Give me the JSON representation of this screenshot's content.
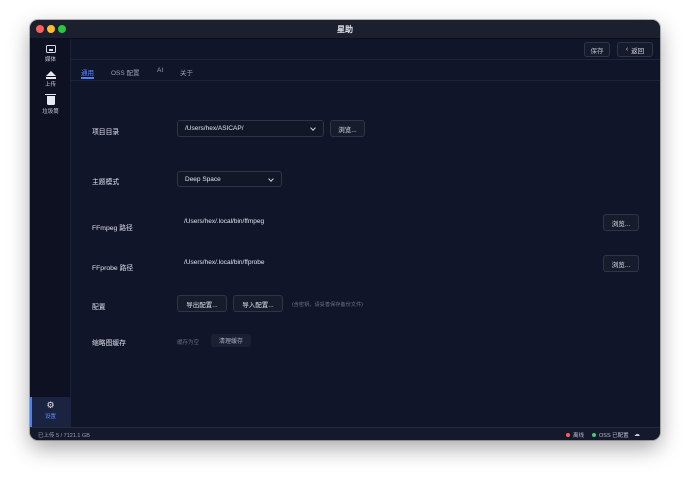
{
  "window": {
    "title": "星助"
  },
  "sidebar": {
    "items": [
      {
        "label": "媒体",
        "icon": "media-icon"
      },
      {
        "label": "上传",
        "icon": "upload-icon"
      },
      {
        "label": "垃圾筒",
        "icon": "trash-icon"
      }
    ],
    "settings": {
      "label": "设置",
      "icon": "gear-icon"
    }
  },
  "topbar": {
    "save_label": "保存",
    "back_label": "返回"
  },
  "tabs": [
    {
      "label": "通用",
      "active": true
    },
    {
      "label": "OSS 配置",
      "active": false
    },
    {
      "label": "AI",
      "active": false
    },
    {
      "label": "关于",
      "active": false
    }
  ],
  "settings": {
    "project_dir": {
      "label": "项目目录",
      "value": "/Users/hex/ASICAP/",
      "browse_label": "浏览..."
    },
    "theme": {
      "label": "主题模式",
      "value": "Deep Space"
    },
    "ffmpeg": {
      "label": "FFmpeg 路径",
      "value": "/Users/hex/.local/bin/ffmpeg",
      "browse_label": "浏览..."
    },
    "ffprobe": {
      "label": "FFprobe 路径",
      "value": "/Users/hex/.local/bin/ffprobe",
      "browse_label": "浏览..."
    },
    "config": {
      "label": "配置",
      "export_label": "导出配置...",
      "import_label": "导入配置...",
      "hint": "(含密钥，请妥善保存备份文件)"
    },
    "thumb_cache": {
      "label": "缩略图缓存",
      "status": "缓存为空",
      "clear_label": "清理缓存"
    }
  },
  "statusbar": {
    "uploaded": "已上传 5 / 7121.1 GB",
    "offline_label": "离线",
    "offline_color": "#ff5c5c",
    "oss_label": "OSS 已配置",
    "oss_color": "#3ecf6a",
    "cloud_icon": "cloud-icon"
  }
}
